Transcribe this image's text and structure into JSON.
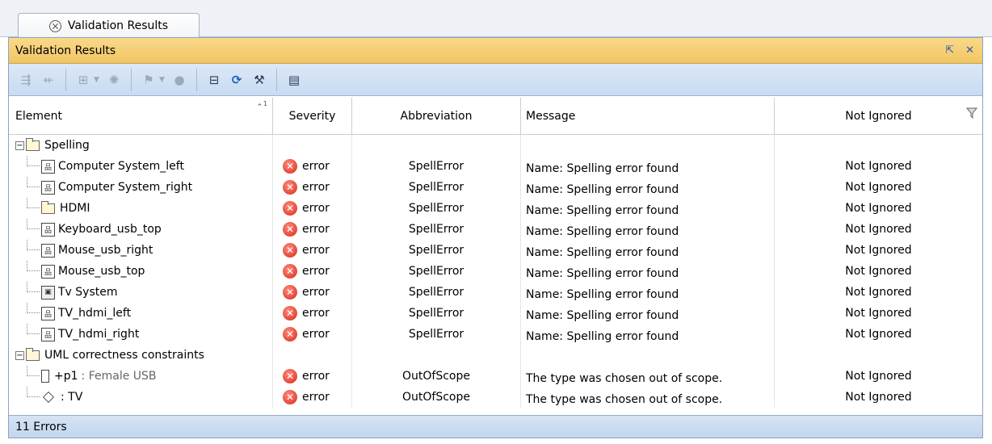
{
  "tab": {
    "label": "Validation Results"
  },
  "panel": {
    "title": "Validation Results",
    "controls": [
      "⇱",
      "✕"
    ]
  },
  "columns": {
    "element": "Element",
    "element_sort": "1",
    "severity": "Severity",
    "abbreviation": "Abbreviation",
    "message": "Message",
    "not_ignored": "Not Ignored"
  },
  "groups": [
    {
      "label": "Spelling",
      "rows": [
        {
          "element": "Computer System_left",
          "icon": "block-icon",
          "severity": "error",
          "abbreviation": "SpellError",
          "message": "Name: Spelling error found",
          "not_ignored": "Not Ignored"
        },
        {
          "element": "Computer System_right",
          "icon": "block-icon",
          "severity": "error",
          "abbreviation": "SpellError",
          "message": "Name: Spelling error found",
          "not_ignored": "Not Ignored"
        },
        {
          "element": "HDMI",
          "icon": "folder-icon",
          "severity": "error",
          "abbreviation": "SpellError",
          "message": "Name: Spelling error found",
          "not_ignored": "Not Ignored"
        },
        {
          "element": "Keyboard_usb_top",
          "icon": "block-icon",
          "severity": "error",
          "abbreviation": "SpellError",
          "message": "Name: Spelling error found",
          "not_ignored": "Not Ignored"
        },
        {
          "element": "Mouse_usb_right",
          "icon": "block-icon",
          "severity": "error",
          "abbreviation": "SpellError",
          "message": "Name: Spelling error found",
          "not_ignored": "Not Ignored"
        },
        {
          "element": "Mouse_usb_top",
          "icon": "block-icon",
          "severity": "error",
          "abbreviation": "SpellError",
          "message": "Name: Spelling error found",
          "not_ignored": "Not Ignored"
        },
        {
          "element": "Tv System",
          "icon": "system-block-icon",
          "severity": "error",
          "abbreviation": "SpellError",
          "message": "Name: Spelling error found",
          "not_ignored": "Not Ignored"
        },
        {
          "element": "TV_hdmi_left",
          "icon": "block-icon",
          "severity": "error",
          "abbreviation": "SpellError",
          "message": "Name: Spelling error found",
          "not_ignored": "Not Ignored"
        },
        {
          "element": "TV_hdmi_right",
          "icon": "block-icon",
          "severity": "error",
          "abbreviation": "SpellError",
          "message": "Name: Spelling error found",
          "not_ignored": "Not Ignored"
        }
      ]
    },
    {
      "label": "UML correctness constraints",
      "rows": [
        {
          "element": "+p1",
          "element_type": ": Female USB",
          "icon": "part-icon",
          "severity": "error",
          "abbreviation": "OutOfScope",
          "message": "The type was chosen out of scope.",
          "not_ignored": "Not Ignored"
        },
        {
          "element": ": TV",
          "element_type": "",
          "icon": "instance-icon",
          "severity": "error",
          "abbreviation": "OutOfScope",
          "message": "The type was chosen out of scope.",
          "not_ignored": "Not Ignored"
        }
      ]
    }
  ],
  "status": {
    "text": "11 Errors"
  },
  "colors": {
    "title_bar": "#f2c564",
    "toolbar": "#c8dbf1",
    "error": "#d8281c",
    "status_bar": "#c2d6ee"
  }
}
